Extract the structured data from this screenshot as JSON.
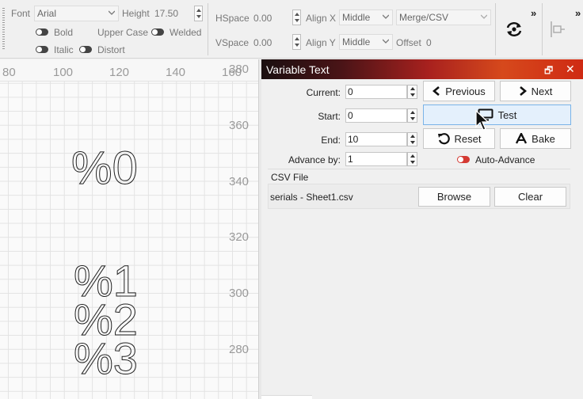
{
  "toolbar": {
    "font_label": "Font",
    "font_value": "Arial",
    "height_label": "Height",
    "height_value": "17.50",
    "hspace_label": "HSpace",
    "hspace_value": "0.00",
    "vspace_label": "VSpace",
    "vspace_value": "0.00",
    "alignx_label": "Align X",
    "alignx_value": "Middle",
    "aligny_label": "Align Y",
    "aligny_value": "Middle",
    "merge_value": "Merge/CSV",
    "offset_label": "Offset",
    "offset_value": "0",
    "bold_label": "Bold",
    "italic_label": "Italic",
    "uppercase_label": "Upper Case",
    "welded_label": "Welded",
    "distort_label": "Distort",
    "more_glyph": "»"
  },
  "canvas": {
    "top_ticks": [
      "80",
      "100",
      "120",
      "140",
      "160"
    ],
    "side_ticks": [
      "380",
      "360",
      "340",
      "320",
      "300",
      "280"
    ],
    "texts": [
      "%0",
      "%1",
      "%2",
      "%3"
    ]
  },
  "panel": {
    "title": "Variable Text",
    "restore_glyph": "🗗",
    "close_glyph": "✕",
    "current_label": "Current:",
    "current_value": "0",
    "start_label": "Start:",
    "start_value": "0",
    "end_label": "End:",
    "end_value": "10",
    "advance_label": "Advance by:",
    "advance_value": "1",
    "previous_label": "Previous",
    "next_label": "Next",
    "test_label": "Test",
    "reset_label": "Reset",
    "bake_label": "Bake",
    "auto_advance_label": "Auto-Advance",
    "csv_group_title": "CSV File",
    "csv_file_name": "serials - Sheet1.csv",
    "browse_label": "Browse",
    "clear_label": "Clear"
  },
  "colors": {
    "accent": "#c0301e",
    "hot_button": "#e4f0fc"
  }
}
